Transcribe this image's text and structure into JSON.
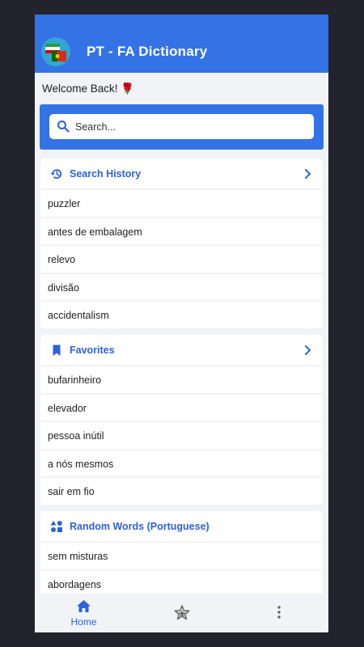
{
  "app": {
    "title": "PT - FA Dictionary"
  },
  "welcome": "Welcome Back! 🌹",
  "search": {
    "placeholder": "Search..."
  },
  "sections": {
    "history": {
      "title": "Search History",
      "items": [
        "puzzler",
        "antes de embalagem",
        "relevo",
        "divisão",
        "accidentalism"
      ]
    },
    "favorites": {
      "title": "Favorites",
      "items": [
        "bufarinheiro",
        "elevador",
        "pessoa inútil",
        "a nós mesmos",
        "sair em fio"
      ]
    },
    "random": {
      "title": "Random Words (Portuguese)",
      "items": [
        "sem misturas",
        "abordagens"
      ]
    }
  },
  "nav": {
    "home_label": "Home",
    "active": "home"
  },
  "colors": {
    "primary": "#3373e6",
    "accent_text": "#2b63d8",
    "background": "#f2f3f6",
    "frame": "#23232d"
  },
  "icons": {
    "logo": "iran-portugal-flags-icon",
    "search": "search-icon",
    "history": "history-icon",
    "favorites": "bookmark-icon",
    "random": "shapes-icon",
    "chevron": "chevron-right-icon",
    "home": "home-icon",
    "stars": "stars-icon",
    "more": "more-vertical-icon"
  }
}
